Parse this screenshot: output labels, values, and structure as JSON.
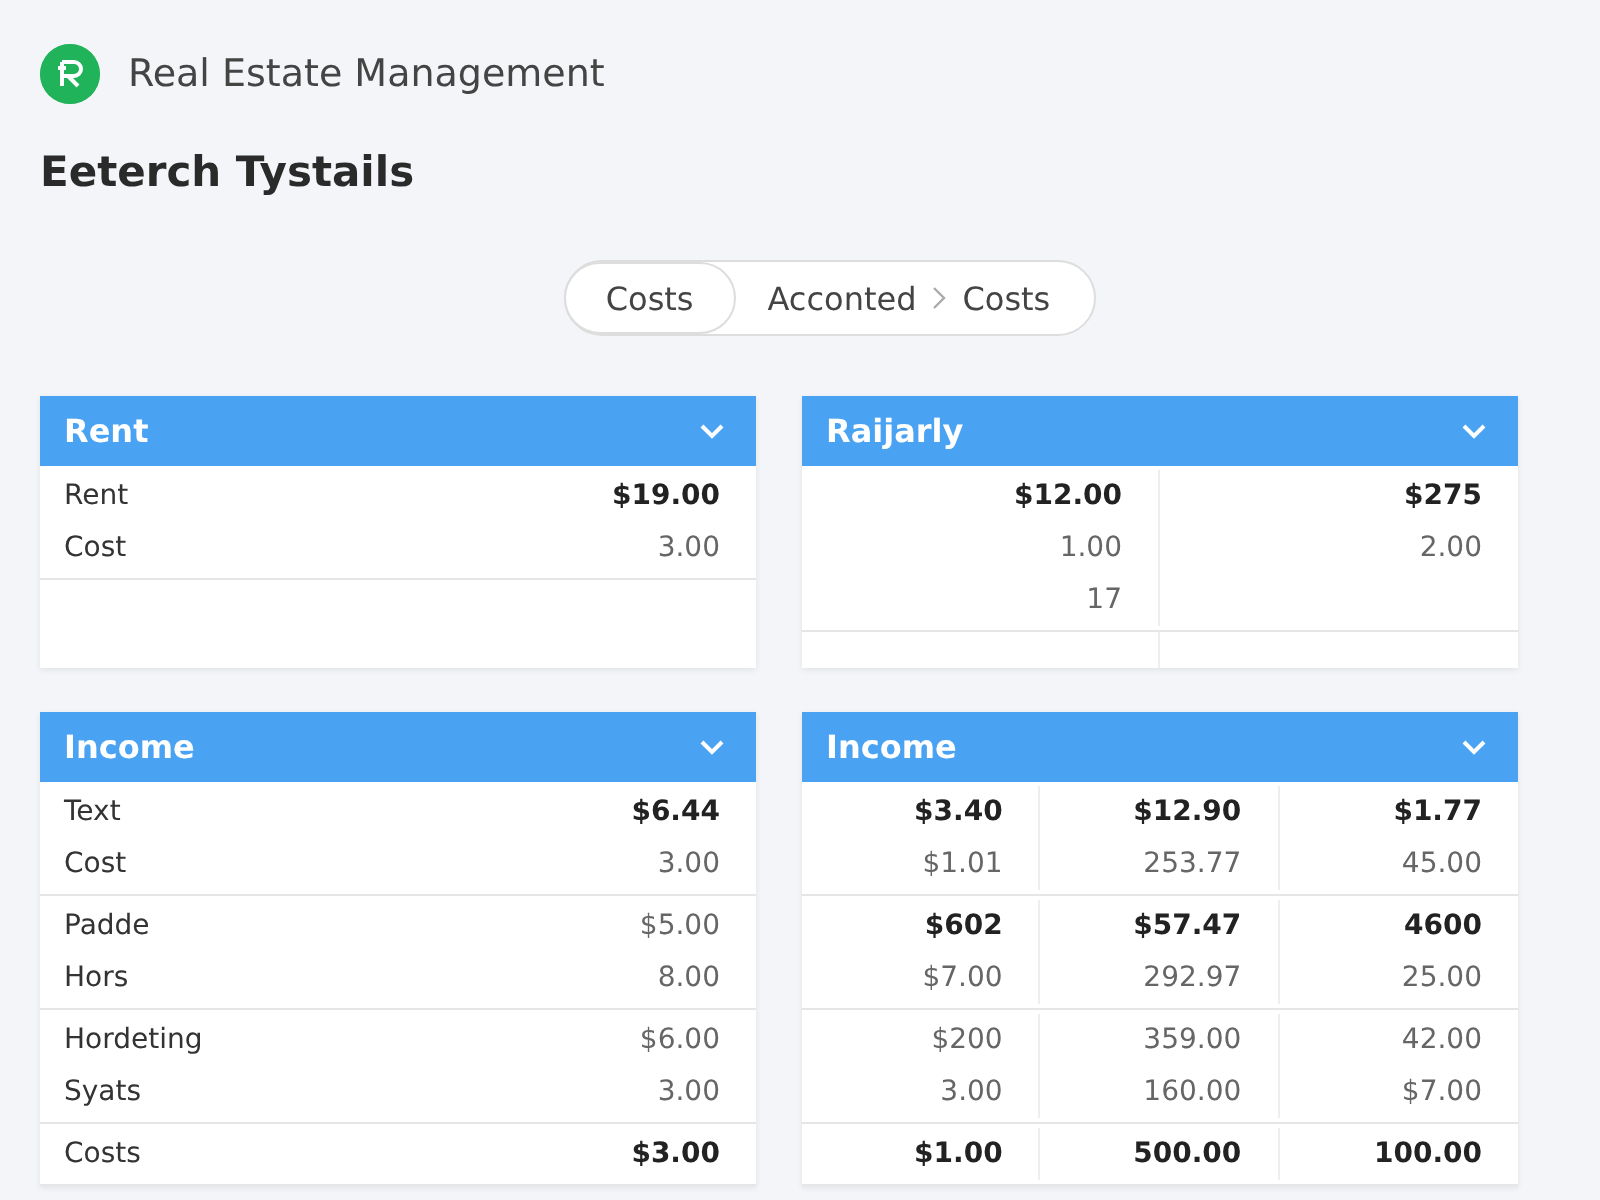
{
  "app": {
    "title": "Real Estate Management"
  },
  "page_title": "Eeterch Tystails",
  "breadcrumb": {
    "first": "Costs",
    "items": [
      "Acconted",
      "Costs"
    ]
  },
  "cards": [
    {
      "title": "Rent",
      "kind": "labeled",
      "groups": [
        [
          {
            "cells": [
              "Rent",
              "$19.00"
            ],
            "bold": true
          },
          {
            "cells": [
              "Cost",
              "3.00"
            ],
            "bold": false
          }
        ]
      ]
    },
    {
      "title": "Raijarly",
      "kind": "numeric",
      "groups": [
        [
          {
            "cells": [
              "$12.00",
              "$275"
            ],
            "bold": true
          },
          {
            "cells": [
              "1.00",
              "2.00"
            ],
            "bold": false
          },
          {
            "cells": [
              "17"
            ],
            "bold": false
          }
        ]
      ]
    },
    {
      "title": "Income",
      "kind": "labeled",
      "groups": [
        [
          {
            "cells": [
              "Text",
              "$6.44"
            ],
            "bold": true
          },
          {
            "cells": [
              "Cost",
              "3.00"
            ],
            "bold": false
          }
        ],
        [
          {
            "cells": [
              "Padde",
              "$5.00"
            ],
            "bold": false
          },
          {
            "cells": [
              "Hors",
              "8.00"
            ],
            "bold": false
          }
        ],
        [
          {
            "cells": [
              "Hordeting",
              "$6.00"
            ],
            "bold": false
          },
          {
            "cells": [
              "Syats",
              "3.00"
            ],
            "bold": false
          }
        ],
        [
          {
            "cells": [
              "Costs",
              "$3.00"
            ],
            "bold": true
          }
        ]
      ]
    },
    {
      "title": "Income",
      "kind": "numeric",
      "groups": [
        [
          {
            "cells": [
              "$3.40",
              "$12.90",
              "$1.77"
            ],
            "bold": true
          },
          {
            "cells": [
              "$1.01",
              "253.77",
              "45.00"
            ],
            "bold": false
          }
        ],
        [
          {
            "cells": [
              "$602",
              "$57.47",
              "4600"
            ],
            "bold": true
          },
          {
            "cells": [
              "$7.00",
              "292.97",
              "25.00"
            ],
            "bold": false
          }
        ],
        [
          {
            "cells": [
              "$200",
              "359.00",
              "42.00"
            ],
            "bold": false
          },
          {
            "cells": [
              "3.00",
              "160.00",
              "$7.00"
            ],
            "bold": false
          }
        ],
        [
          {
            "cells": [
              "$1.00",
              "500.00",
              "100.00"
            ],
            "bold": true
          }
        ]
      ]
    }
  ]
}
